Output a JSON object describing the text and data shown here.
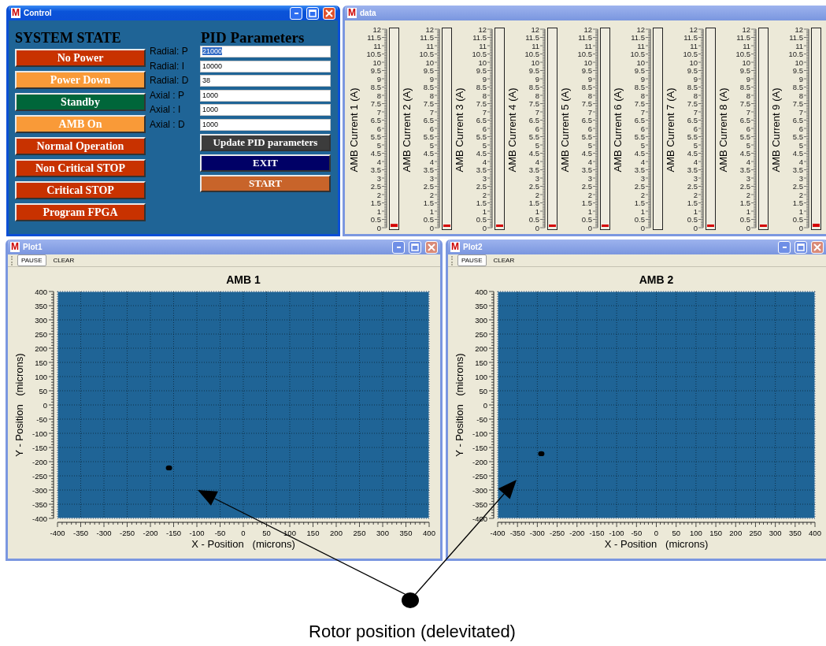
{
  "control_window": {
    "icon": "M",
    "title": "Control",
    "active": true,
    "show_controls": true,
    "system_state": {
      "heading": "SYSTEM STATE",
      "buttons": [
        {
          "label": "No Power",
          "color": "#c83200"
        },
        {
          "label": "Power Down",
          "color": "#f99a38"
        },
        {
          "label": "Standby",
          "color": "#00663a"
        },
        {
          "label": "AMB On",
          "color": "#f99a38"
        },
        {
          "label": "Normal Operation",
          "color": "#c83200"
        },
        {
          "label": "Non Critical STOP",
          "color": "#c83200"
        },
        {
          "label": "Critical STOP",
          "color": "#c83200"
        },
        {
          "label": "Program FPGA",
          "color": "#c83200"
        }
      ]
    },
    "pid": {
      "heading": "PID Parameters",
      "fields": [
        {
          "label": "Radial: P",
          "value": "21000",
          "selected": true
        },
        {
          "label": "Radial: I",
          "value": "10000",
          "selected": false
        },
        {
          "label": "Radial: D",
          "value": "38",
          "selected": false
        },
        {
          "label": "Axial : P",
          "value": "1000",
          "selected": false
        },
        {
          "label": "Axial : I",
          "value": "1000",
          "selected": false
        },
        {
          "label": "Axial : D",
          "value": "1000",
          "selected": false
        }
      ],
      "buttons": [
        {
          "label": "Update PID parameters",
          "color": "#3c3c3c"
        },
        {
          "label": "EXIT",
          "color": "#000066"
        },
        {
          "label": "START",
          "color": "#c8642a"
        }
      ]
    }
  },
  "data_window": {
    "icon": "M",
    "title": "data",
    "active": false,
    "meters": [
      {
        "label": "AMB Current 1 (A)",
        "level": 0.015,
        "ticks": [
          "12",
          "11.5",
          "11",
          "10.5",
          "10",
          "9.5",
          "9",
          "8.5",
          "8",
          "7.5",
          "7",
          "6.5",
          "6",
          "5.5",
          "5",
          "4.5",
          "4",
          "3.5",
          "3",
          "2.5",
          "2",
          "1.5",
          "1",
          "0.5",
          "0"
        ]
      },
      {
        "label": "AMB Current 2 (A)",
        "level": 0.006,
        "ticks": [
          "12",
          "11.5",
          "11",
          "10.5",
          "10",
          "9.5",
          "9",
          "8.5",
          "8",
          "7.5",
          "7",
          "6.5",
          "6",
          "5.5",
          "5",
          "4.5",
          "4",
          "3.5",
          "3",
          "2.5",
          "2",
          "1.5",
          "1",
          "0.5",
          "0"
        ]
      },
      {
        "label": "AMB Current 3 (A)",
        "level": 0.009,
        "ticks": [
          "12",
          "11.5",
          "11",
          "10.5",
          "10",
          "9.5",
          "9",
          "8.5",
          "8",
          "7.5",
          "7",
          "6.5",
          "6",
          "5.5",
          "5",
          "4.5",
          "4",
          "3.5",
          "3",
          "2.5",
          "2",
          "1.5",
          "1",
          "0.5",
          "0"
        ]
      },
      {
        "label": "AMB Current 4 (A)",
        "level": 0.009,
        "ticks": [
          "12",
          "11.5",
          "11",
          "10.5",
          "10",
          "9.5",
          "9",
          "8.5",
          "8",
          "7.5",
          "7",
          "6.5",
          "6",
          "5.5",
          "5",
          "4.5",
          "4",
          "3.5",
          "3",
          "2.5",
          "2",
          "1.5",
          "1",
          "0.5",
          "0"
        ]
      },
      {
        "label": "AMB Current 5 (A)",
        "level": 0.009,
        "ticks": [
          "12",
          "11.5",
          "11",
          "10.5",
          "10",
          "9.5",
          "9",
          "8.5",
          "8",
          "7.5",
          "7",
          "6.5",
          "6",
          "5.5",
          "5",
          "4.5",
          "4",
          "3.5",
          "3",
          "2.5",
          "2",
          "1.5",
          "1",
          "0.5",
          "0"
        ]
      },
      {
        "label": "AMB Current 6 (A)",
        "ticks": [
          "12",
          "11.5",
          "11",
          "10.5",
          "10",
          "9.5",
          "9",
          "8.5",
          "8",
          "7.5",
          "7",
          "6.5",
          "6",
          "5.5",
          "5",
          "4.5",
          "4",
          "3.5",
          "3",
          "2.5",
          "2",
          "1.5",
          "1",
          "0.5",
          "0"
        ]
      },
      {
        "label": "AMB Current 7 (A)",
        "level": 0.012,
        "ticks": [
          "12",
          "11.5",
          "11",
          "10.5",
          "10",
          "9.5",
          "9",
          "8.5",
          "8",
          "7.5",
          "7",
          "6.5",
          "6",
          "5.5",
          "5",
          "4.5",
          "4",
          "3.5",
          "3",
          "2.5",
          "2",
          "1.5",
          "1",
          "0.5",
          "0"
        ]
      },
      {
        "label": "AMB Current 8 (A)",
        "level": 0.006,
        "ticks": [
          "12",
          "11.5",
          "11",
          "10.5",
          "10",
          "9.5",
          "9",
          "8.5",
          "8",
          "7.5",
          "7",
          "6.5",
          "6",
          "5.5",
          "5",
          "4.5",
          "4",
          "3.5",
          "3",
          "2.5",
          "2",
          "1.5",
          "1",
          "0.5",
          "0"
        ]
      },
      {
        "label": "AMB Current 9 (A)",
        "level": 0.016,
        "ticks": [
          "12",
          "11.5",
          "11",
          "10.5",
          "10",
          "9.5",
          "9",
          "8.5",
          "8",
          "7.5",
          "7",
          "6.5",
          "6",
          "5.5",
          "5",
          "4.5",
          "4",
          "3.5",
          "3",
          "2.5",
          "2",
          "1.5",
          "1",
          "0.5",
          "0"
        ]
      }
    ]
  },
  "plot_windows": [
    {
      "icon": "M",
      "title": "Plot1",
      "active": false,
      "show_controls": true,
      "toolbar": [
        {
          "label": "PAUSE",
          "kind": "outlined"
        },
        {
          "label": "CLEAR",
          "kind": "flat"
        }
      ],
      "chart_data": {
        "type": "scatter",
        "grid": true,
        "title": "AMB 1",
        "xlabel": "X - Position   (microns)",
        "ylabel": "Y - Position   (microns)",
        "x": [
          -160
        ],
        "series": [
          {
            "color": "#000000",
            "values": [
              -222
            ]
          }
        ],
        "xlim": [
          -400,
          400
        ],
        "ylim": [
          -400,
          400
        ],
        "xticks": [
          -400,
          -350,
          -300,
          -250,
          -200,
          -150,
          -100,
          -50,
          0,
          50,
          100,
          150,
          200,
          250,
          300,
          350,
          400
        ],
        "yticks": [
          -400,
          -350,
          -300,
          -250,
          -200,
          -150,
          -100,
          -50,
          0,
          50,
          100,
          150,
          200,
          250,
          300,
          350,
          400
        ]
      }
    },
    {
      "icon": "M",
      "title": "Plot2",
      "active": false,
      "show_controls": true,
      "toolbar": [
        {
          "label": "PAUSE",
          "kind": "outlined"
        },
        {
          "label": "CLEAR",
          "kind": "flat"
        }
      ],
      "chart_data": {
        "type": "scatter",
        "grid": true,
        "title": "AMB 2",
        "xlabel": "X - Position   (microns)",
        "ylabel": "Y - Position   (microns)",
        "x": [
          -290
        ],
        "series": [
          {
            "color": "#000000",
            "values": [
              -172
            ]
          }
        ],
        "xlim": [
          -400,
          400
        ],
        "ylim": [
          -400,
          400
        ],
        "xticks": [
          -400,
          -350,
          -300,
          -250,
          -200,
          -150,
          -100,
          -50,
          0,
          50,
          100,
          150,
          200,
          250,
          300,
          350,
          400
        ],
        "yticks": [
          -400,
          -350,
          -300,
          -250,
          -200,
          -150,
          -100,
          -50,
          0,
          50,
          100,
          150,
          200,
          250,
          300,
          350,
          400
        ]
      }
    }
  ],
  "annotation": {
    "caption": "Rotor position (delevitated)"
  }
}
